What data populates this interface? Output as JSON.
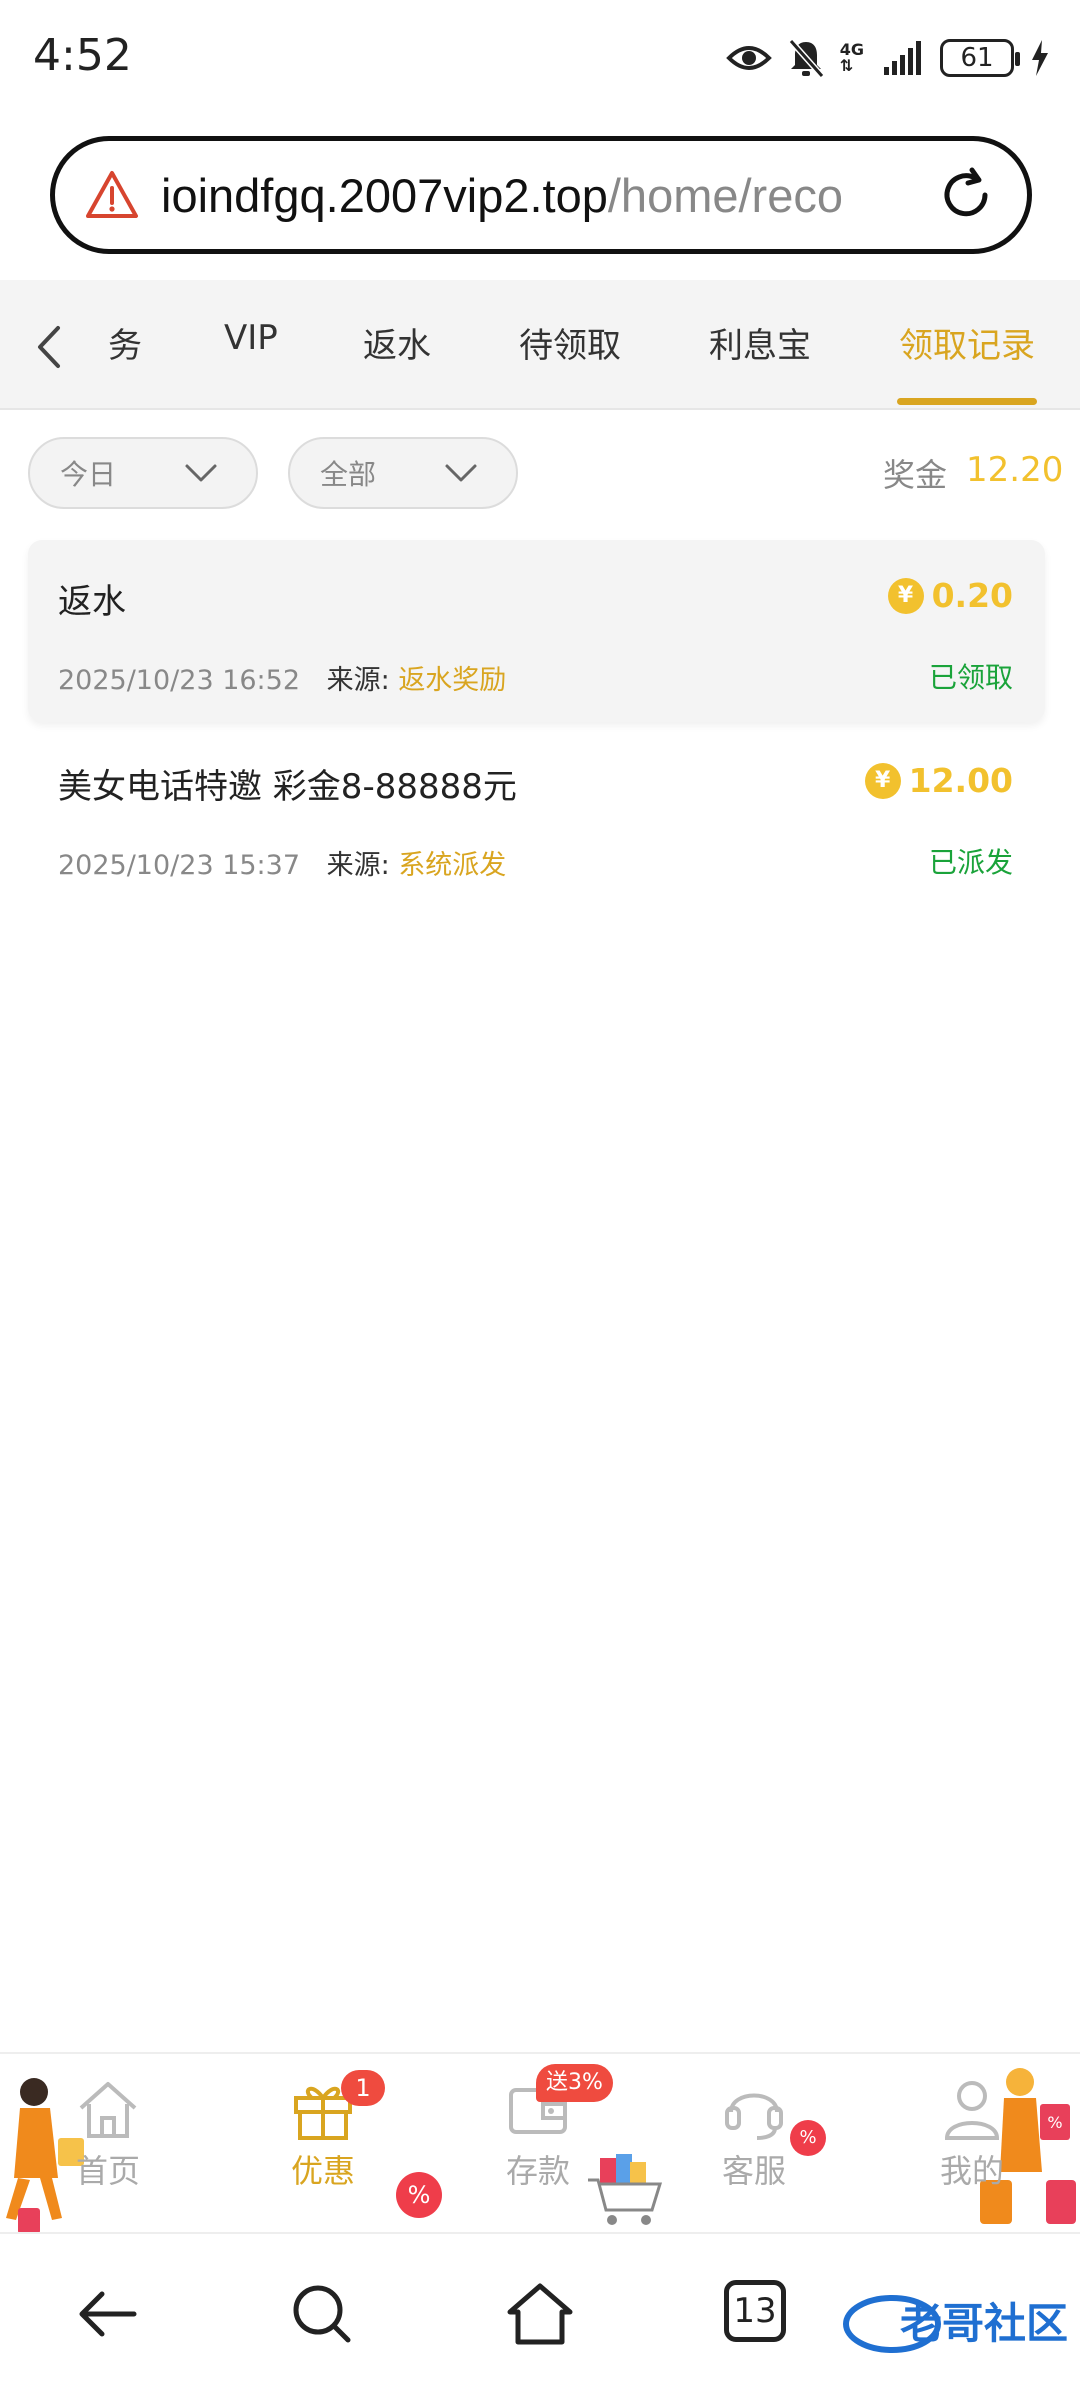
{
  "status_bar": {
    "time": "4:52",
    "network": "4G",
    "battery": "61"
  },
  "browser": {
    "url_host": "ioindfgq.2007vip2.top",
    "url_path": "/home/reco"
  },
  "tabs": {
    "items": [
      {
        "label": "务"
      },
      {
        "label": "VIP"
      },
      {
        "label": "返水"
      },
      {
        "label": "待领取"
      },
      {
        "label": "利息宝"
      },
      {
        "label": "领取记录",
        "active": true
      }
    ]
  },
  "filters": {
    "date": "今日",
    "type": "全部",
    "bonus_label": "奖金",
    "bonus_value": "12.20"
  },
  "records": [
    {
      "title": "返水",
      "amount": "0.20",
      "date": "2025/10/23 16:52",
      "source_label": "来源:",
      "source": "返水奖励",
      "status": "已领取"
    },
    {
      "title": "美女电话特邀 彩金8-88888元",
      "amount": "12.00",
      "date": "2025/10/23 15:37",
      "source_label": "来源:",
      "source": "系统派发",
      "status": "已派发"
    }
  ],
  "currency_symbol": "¥",
  "app_nav": {
    "items": [
      {
        "label": "首页",
        "icon": "home-icon"
      },
      {
        "label": "优惠",
        "icon": "gift-icon",
        "badge": "1",
        "active": true
      },
      {
        "label": "存款",
        "icon": "wallet-icon",
        "promo": "送3%"
      },
      {
        "label": "客服",
        "icon": "headset-icon"
      },
      {
        "label": "我的",
        "icon": "user-icon"
      }
    ],
    "discount_tag": "%"
  },
  "system_nav": {
    "tab_count": "13"
  },
  "watermark": {
    "text": "老哥社区"
  },
  "colors": {
    "accent": "#d9a520",
    "coin": "#f2c12e",
    "success": "#1aa33a",
    "badge": "#ef4b3f"
  }
}
